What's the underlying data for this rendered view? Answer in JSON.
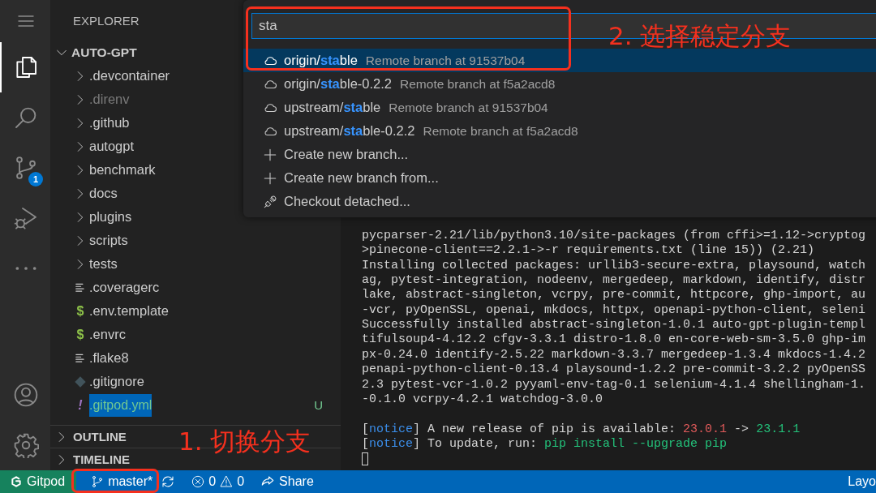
{
  "activity_bar": {
    "items": [
      {
        "kind": "menu",
        "selected": false
      },
      {
        "kind": "explorer",
        "selected": true
      },
      {
        "kind": "search",
        "selected": false
      },
      {
        "kind": "source-control",
        "selected": false,
        "badge": "1"
      },
      {
        "kind": "run",
        "selected": false
      },
      {
        "kind": "more",
        "selected": false
      },
      {
        "kind": "account",
        "selected": false
      },
      {
        "kind": "settings",
        "selected": false
      }
    ]
  },
  "sidebar": {
    "title": "EXPLORER",
    "root": {
      "name": "AUTO-GPT",
      "expanded": true,
      "children": [
        {
          "name": ".devcontainer",
          "kind": "folder",
          "expanded": false,
          "dimmed": false
        },
        {
          "name": ".direnv",
          "kind": "folder",
          "expanded": false,
          "dimmed": true
        },
        {
          "name": ".github",
          "kind": "folder",
          "expanded": false,
          "dimmed": false
        },
        {
          "name": "autogpt",
          "kind": "folder",
          "expanded": false,
          "dimmed": false
        },
        {
          "name": "benchmark",
          "kind": "folder",
          "expanded": false,
          "dimmed": false
        },
        {
          "name": "docs",
          "kind": "folder",
          "expanded": false,
          "dimmed": false
        },
        {
          "name": "plugins",
          "kind": "folder",
          "expanded": false,
          "dimmed": false
        },
        {
          "name": "scripts",
          "kind": "folder",
          "expanded": false,
          "dimmed": false
        },
        {
          "name": "tests",
          "kind": "folder",
          "expanded": false,
          "dimmed": false
        },
        {
          "name": ".coveragerc",
          "kind": "text-file",
          "dimmed": false
        },
        {
          "name": ".env.template",
          "kind": "shell-file",
          "glyph": "$",
          "dimmed": false
        },
        {
          "name": ".envrc",
          "kind": "shell-file",
          "glyph": "$",
          "dimmed": false
        },
        {
          "name": ".flake8",
          "kind": "text-file",
          "dimmed": false
        },
        {
          "name": ".gitignore",
          "kind": "git-file",
          "dimmed": false
        },
        {
          "name": ".gitpod.yml",
          "kind": "yaml-file",
          "glyph": "!",
          "dimmed": false,
          "status": "U"
        }
      ]
    },
    "sections": [
      {
        "title": "OUTLINE",
        "expanded": false
      },
      {
        "title": "TIMELINE",
        "expanded": false
      }
    ]
  },
  "quick_pick": {
    "query": "sta",
    "items": [
      {
        "kind": "remote-branch",
        "label": "origin/**sta**ble",
        "description": "Remote branch at 91537b04",
        "selected": true
      },
      {
        "kind": "remote-branch",
        "label": "origin/**sta**ble-0.2.2",
        "description": "Remote branch at f5a2acd8",
        "selected": false
      },
      {
        "kind": "remote-branch",
        "label": "upstream/**sta**ble",
        "description": "Remote branch at 91537b04",
        "selected": false
      },
      {
        "kind": "remote-branch",
        "label": "upstream/**sta**ble-0.2.2",
        "description": "Remote branch at f5a2acd8",
        "selected": false
      },
      {
        "kind": "create",
        "label": "Create new branch...",
        "selected": false
      },
      {
        "kind": "create",
        "label": "Create new branch from...",
        "selected": false
      },
      {
        "kind": "detach",
        "label": "Checkout detached...",
        "selected": false
      }
    ]
  },
  "terminal": {
    "output": [
      "pycparser-2.21/lib/python3.10/site-packages (from cffi>=1.12->cryptog",
      ">pinecone-client==2.2.1->-r requirements.txt (line 15)) (2.21)",
      "Installing collected packages: urllib3-secure-extra, playsound, watch",
      "ag, pytest-integration, nodeenv, mergedeep, markdown, identify, distr",
      "lake, abstract-singleton, vcrpy, pre-commit, httpcore, ghp-import, au",
      "-vcr, pyOpenSSL, openai, mkdocs, httpx, openapi-python-client, seleni",
      "Successfully installed abstract-singleton-1.0.1 auto-gpt-plugin-templ",
      "tifulsoup4-4.12.2 cfgv-3.3.1 distro-1.8.0 en-core-web-sm-3.5.0 ghp-im",
      "px-0.24.0 identify-2.5.22 markdown-3.3.7 mergedeep-1.3.4 mkdocs-1.4.2",
      "penapi-python-client-0.13.4 playsound-1.2.2 pre-commit-3.2.2 pyOpenSS",
      "2.3 pytest-vcr-1.0.2 pyyaml-env-tag-0.1 selenium-4.1.4 shellingham-1.",
      "-0.1.0 vcrpy-4.2.1 watchdog-3.0.0"
    ],
    "notices": [
      {
        "segments": [
          {
            "text": "[",
            "kind": "plain"
          },
          {
            "text": "notice",
            "kind": "label"
          },
          {
            "text": "] A new release of pip is available: ",
            "kind": "plain"
          },
          {
            "text": "23.0.1",
            "kind": "old"
          },
          {
            "text": " -> ",
            "kind": "plain"
          },
          {
            "text": "23.1.1",
            "kind": "new"
          }
        ]
      },
      {
        "segments": [
          {
            "text": "[",
            "kind": "plain"
          },
          {
            "text": "notice",
            "kind": "label"
          },
          {
            "text": "] To update, run: ",
            "kind": "plain"
          },
          {
            "text": "pip install --upgrade pip",
            "kind": "new"
          }
        ]
      }
    ]
  },
  "status_bar": {
    "remote": "Gitpod",
    "branch": "master*",
    "errors": "0",
    "warnings": "0",
    "share": "Share",
    "layout": "Layo"
  },
  "annotations": [
    {
      "text": "2. 选择稳定分支"
    },
    {
      "text": "1. 切换分支"
    }
  ]
}
